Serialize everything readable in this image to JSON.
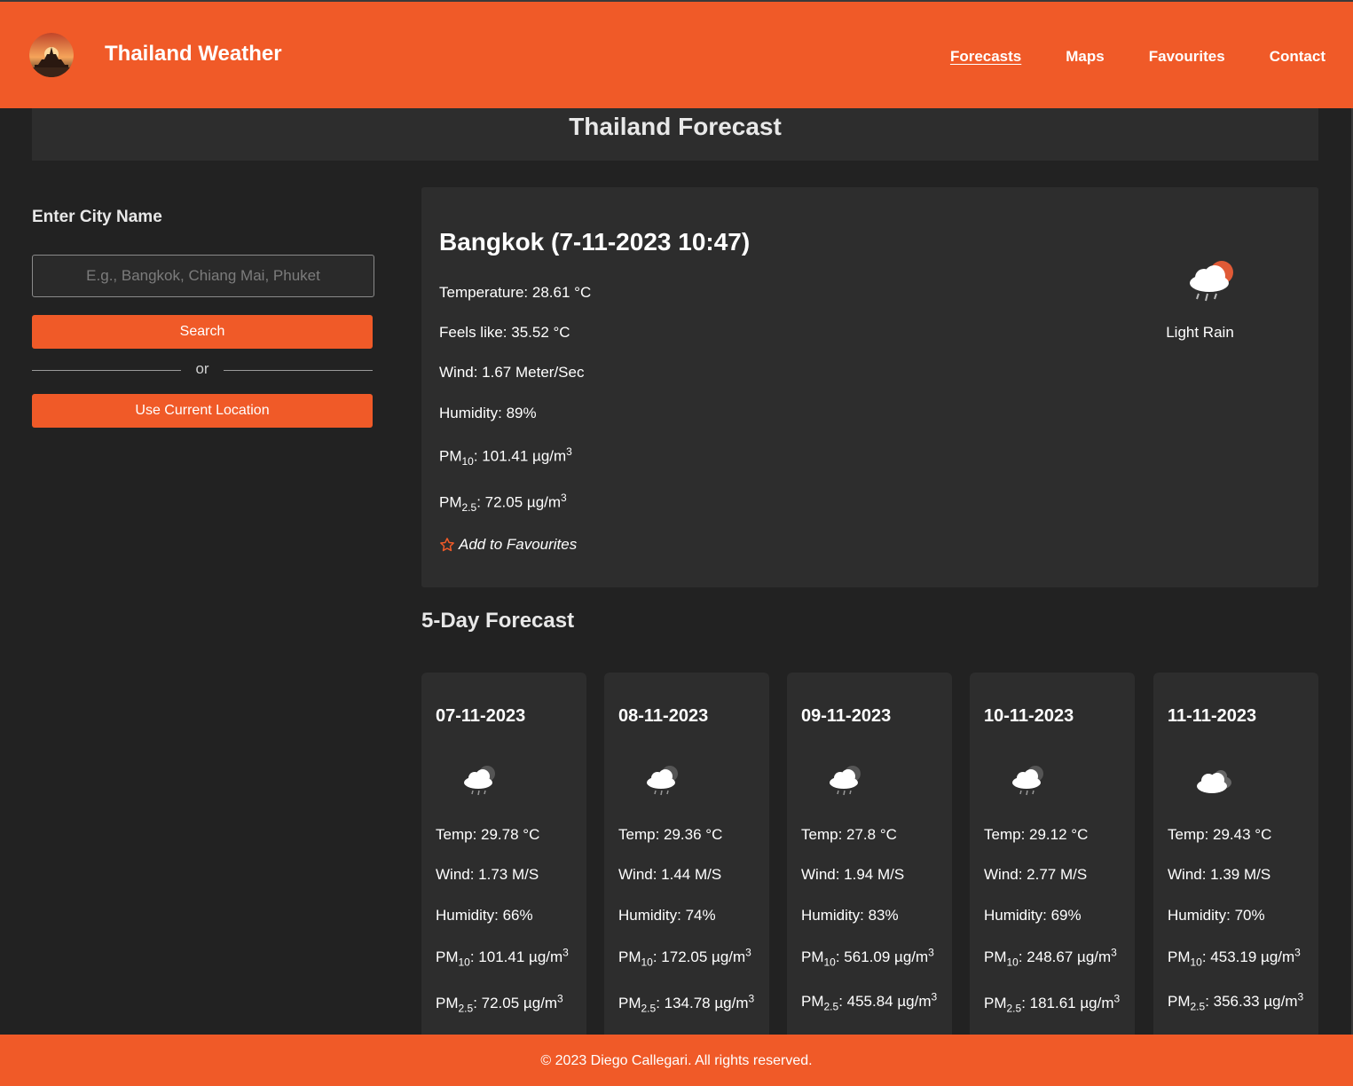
{
  "header": {
    "brand": "Thailand Weather",
    "nav": [
      {
        "label": "Forecasts",
        "active": true
      },
      {
        "label": "Maps",
        "active": false
      },
      {
        "label": "Favourites",
        "active": false
      },
      {
        "label": "Contact",
        "active": false
      }
    ],
    "accent_color": "#f05a28"
  },
  "page_title": "Thailand Forecast",
  "sidebar": {
    "label": "Enter City Name",
    "input_placeholder": "E.g., Bangkok, Chiang Mai, Phuket",
    "input_value": "",
    "search_label": "Search",
    "or_label": "or",
    "location_label": "Use Current Location"
  },
  "current": {
    "title": "Bangkok (7-11-2023 10:47)",
    "temperature": "Temperature: 28.61 °C",
    "feels_like": "Feels like: 35.52 °C",
    "wind": "Wind: 1.67 Meter/Sec",
    "humidity": "Humidity: 89%",
    "pm10": ": 101.41 µg/m",
    "pm25": ": 72.05 µg/m",
    "favourite_label": "Add to Favourites",
    "icon": "light-rain-icon",
    "description": "Light Rain"
  },
  "forecast": {
    "heading": "5-Day Forecast",
    "days": [
      {
        "date": "07-11-2023",
        "temp": "Temp: 29.78 °C",
        "wind": "Wind: 1.73 M/S",
        "humidity": "Humidity: 66%",
        "pm10": ": 101.41 µg/m",
        "pm25": ": 72.05 µg/m",
        "icon": "rain-cloud-icon"
      },
      {
        "date": "08-11-2023",
        "temp": "Temp: 29.36 °C",
        "wind": "Wind: 1.44 M/S",
        "humidity": "Humidity: 74%",
        "pm10": ": 172.05 µg/m",
        "pm25": ": 134.78 µg/m",
        "icon": "rain-cloud-icon"
      },
      {
        "date": "09-11-2023",
        "temp": "Temp: 27.8 °C",
        "wind": "Wind: 1.94 M/S",
        "humidity": "Humidity: 83%",
        "pm10": ": 561.09 µg/m",
        "pm25": ": 455.84 µg/m",
        "icon": "rain-cloud-icon"
      },
      {
        "date": "10-11-2023",
        "temp": "Temp: 29.12 °C",
        "wind": "Wind: 2.77 M/S",
        "humidity": "Humidity: 69%",
        "pm10": ": 248.67 µg/m",
        "pm25": ": 181.61 µg/m",
        "icon": "rain-cloud-icon"
      },
      {
        "date": "11-11-2023",
        "temp": "Temp: 29.43 °C",
        "wind": "Wind: 1.39 M/S",
        "humidity": "Humidity: 70%",
        "pm10": ": 453.19 µg/m",
        "pm25": ": 356.33 µg/m",
        "icon": "cloud-icon"
      }
    ]
  },
  "footer": "© 2023 Diego Callegari. All rights reserved."
}
